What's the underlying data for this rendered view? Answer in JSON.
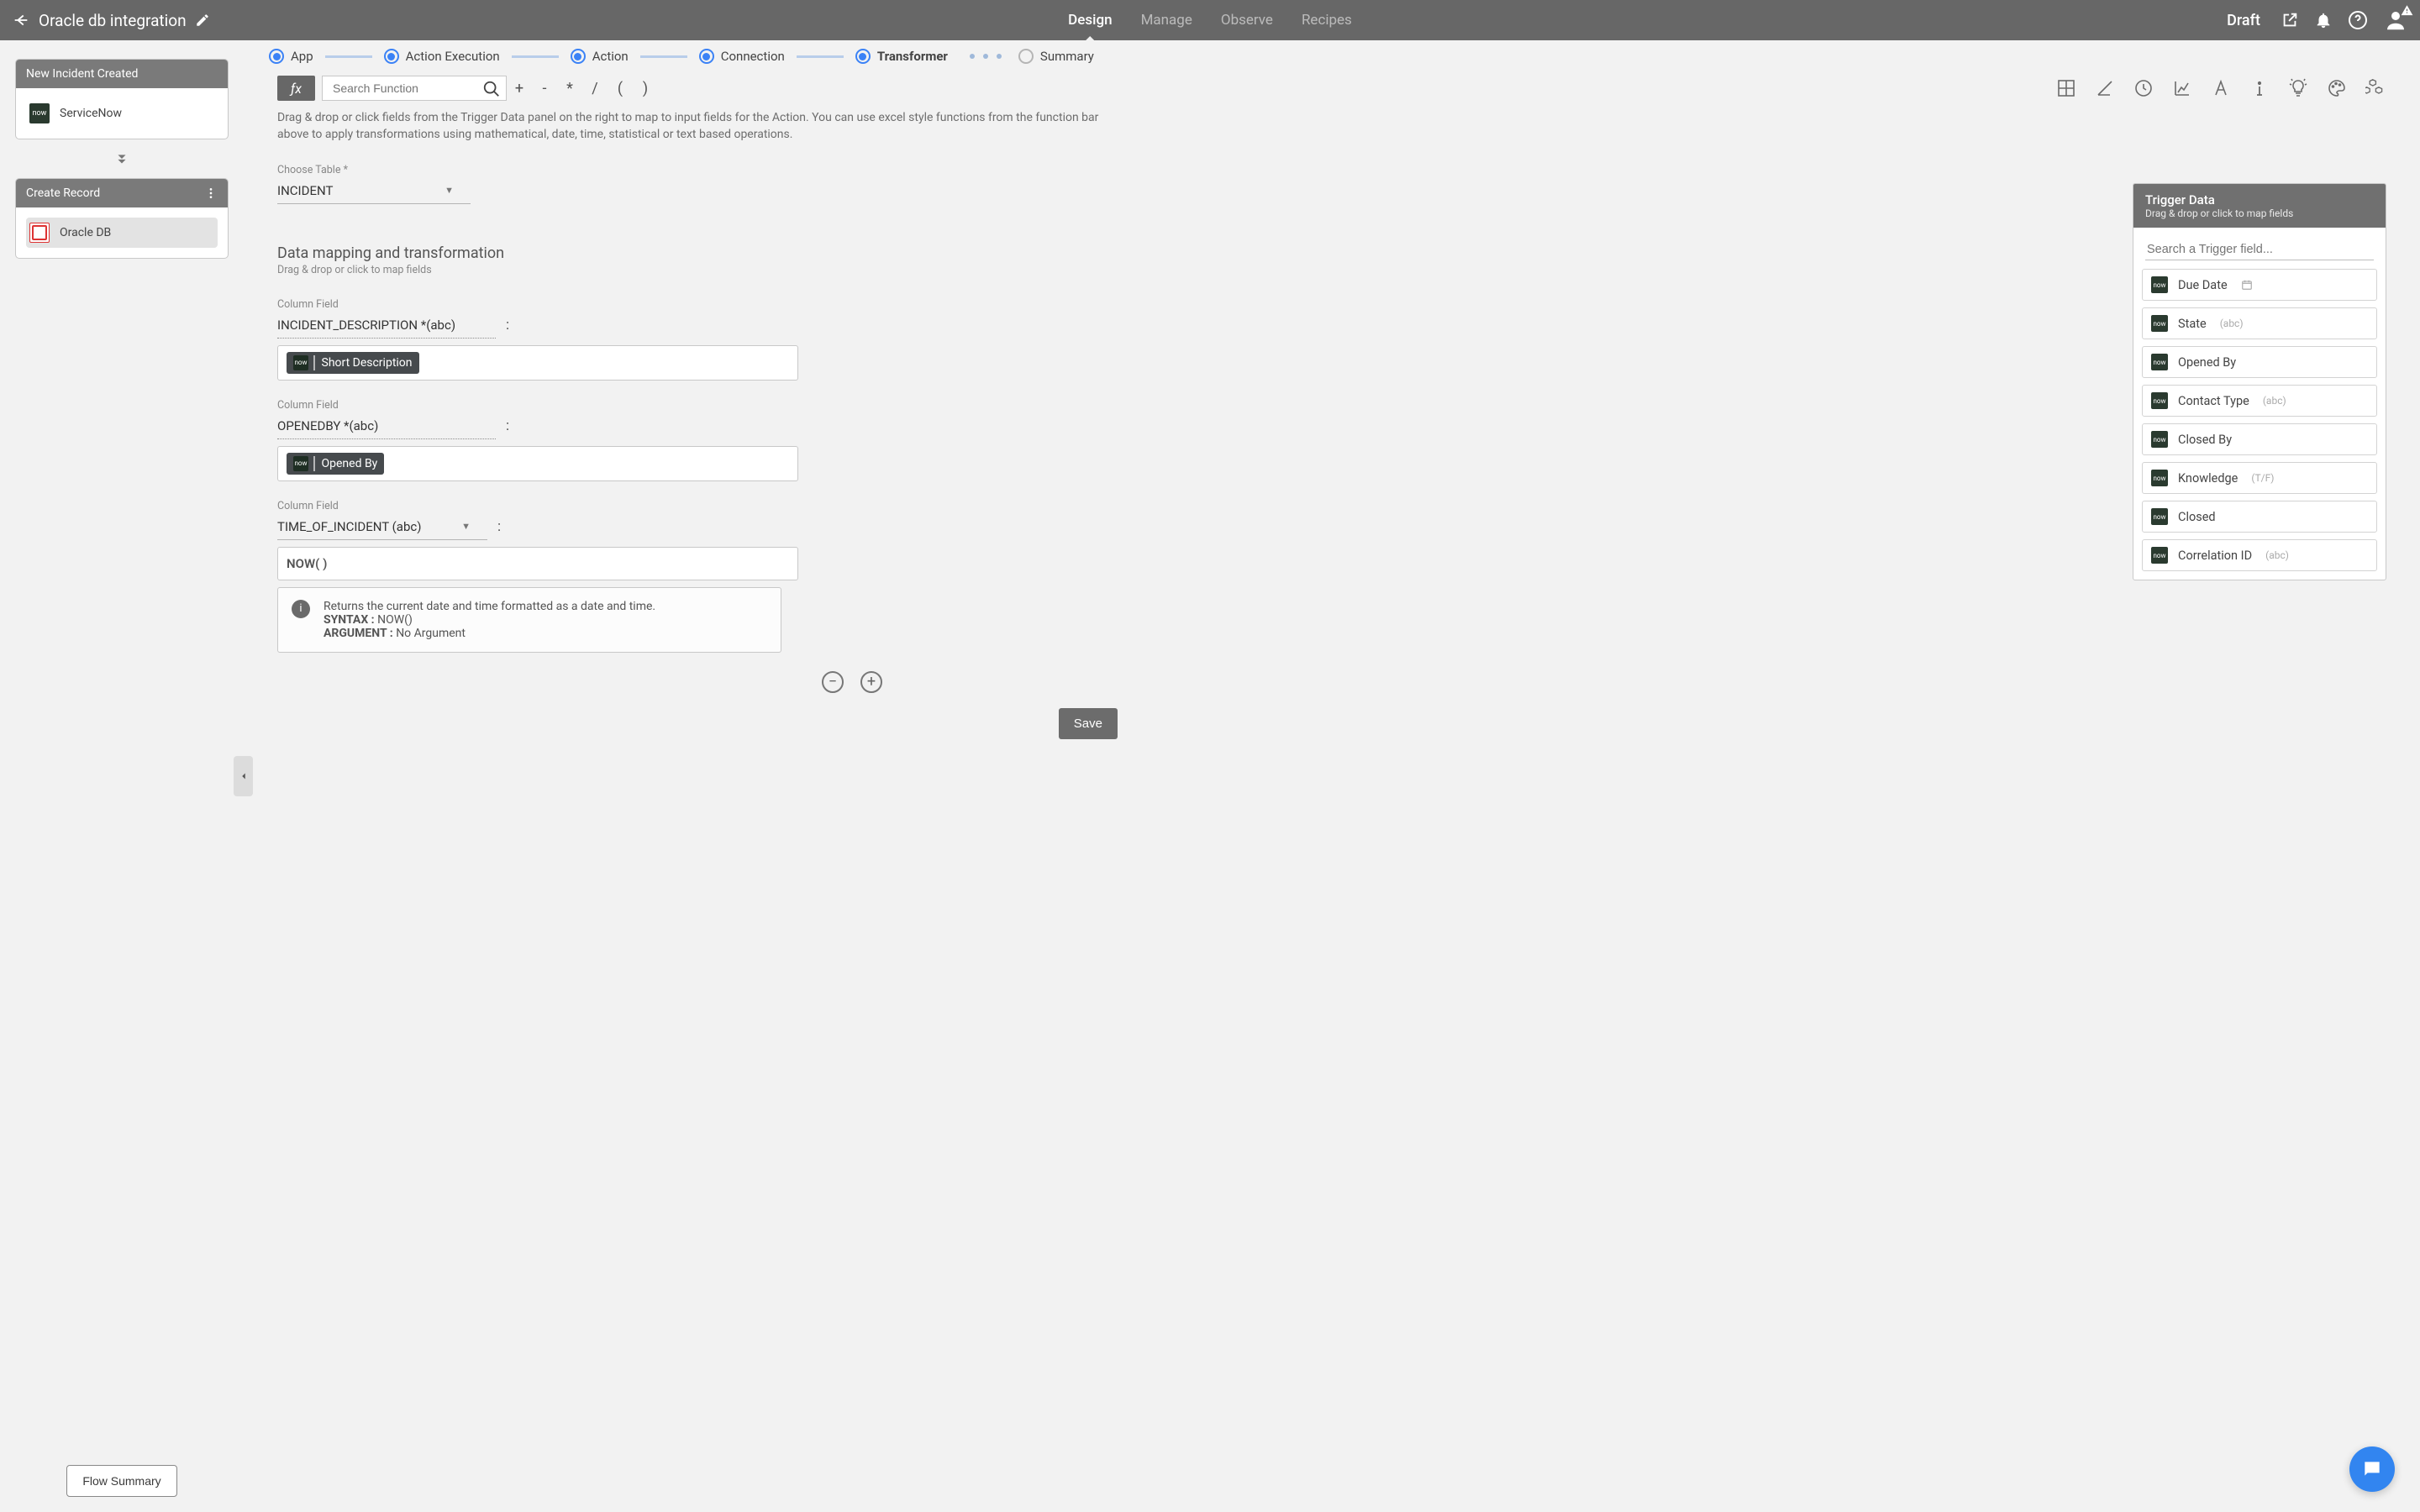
{
  "header": {
    "title": "Oracle db integration",
    "tabs": [
      "Design",
      "Manage",
      "Observe",
      "Recipes"
    ],
    "active_tab": "Design",
    "status": "Draft"
  },
  "stepper": {
    "steps": [
      "App",
      "Action Execution",
      "Action",
      "Connection",
      "Transformer",
      "Summary"
    ],
    "current": "Transformer"
  },
  "flow": {
    "trigger": {
      "title": "New Incident Created",
      "app": "ServiceNow"
    },
    "action": {
      "title": "Create Record",
      "app": "Oracle DB"
    },
    "summary_button": "Flow Summary"
  },
  "func_bar": {
    "search_placeholder": "Search Function",
    "operators": [
      "+",
      "-",
      "*",
      "/",
      "(",
      ")"
    ]
  },
  "hint": "Drag & drop or click fields from the Trigger Data panel on the right to map to input fields for the Action. You can use excel style functions from the function bar above to apply transformations using mathematical, date, time, statistical or text based operations.",
  "table": {
    "label": "Choose Table *",
    "value": "INCIDENT"
  },
  "mapping": {
    "heading": "Data mapping and transformation",
    "sub": "Drag & drop or click to map fields",
    "col_label": "Column Field",
    "rows": [
      {
        "column": "INCIDENT_DESCRIPTION *(abc)",
        "value_chip": "Short Description",
        "plain": null
      },
      {
        "column": "OPENEDBY *(abc)",
        "value_chip": "Opened By",
        "plain": null
      },
      {
        "column": "TIME_OF_INCIDENT (abc)",
        "value_chip": null,
        "plain": "NOW( )"
      }
    ],
    "help": {
      "line1": "Returns the current date and time formatted as a date and time.",
      "syntax_label": "SYNTAX :",
      "syntax_value": "NOW()",
      "arg_label": "ARGUMENT :",
      "arg_value": "No Argument"
    }
  },
  "trigger_panel": {
    "title": "Trigger Data",
    "sub": "Drag & drop or click to map fields",
    "search_placeholder": "Search a Trigger field...",
    "fields": [
      {
        "name": "Due Date",
        "suffix_icon": "calendar"
      },
      {
        "name": "State",
        "suffix": "(abc)"
      },
      {
        "name": "Opened By",
        "suffix": ""
      },
      {
        "name": "Contact Type",
        "suffix": "(abc)"
      },
      {
        "name": "Closed By",
        "suffix": ""
      },
      {
        "name": "Knowledge",
        "suffix": "(T/F)"
      },
      {
        "name": "Closed",
        "suffix": ""
      },
      {
        "name": "Correlation ID",
        "suffix": "(abc)"
      }
    ]
  },
  "save_label": "Save"
}
